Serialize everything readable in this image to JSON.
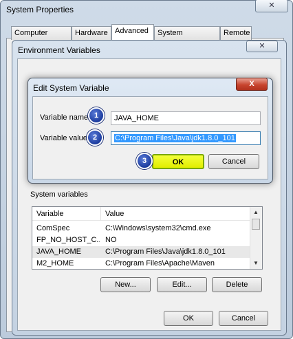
{
  "system_properties": {
    "title": "System Properties",
    "close_label": "✕",
    "tabs": [
      {
        "label": "Computer Name"
      },
      {
        "label": "Hardware"
      },
      {
        "label": "Advanced"
      },
      {
        "label": "System Protection"
      },
      {
        "label": "Remote"
      }
    ],
    "active_tab": "Advanced"
  },
  "environment_variables": {
    "title": "Environment Variables",
    "close_label": "✕",
    "system_variables": {
      "group_label": "System variables",
      "columns": [
        "Variable",
        "Value"
      ],
      "rows": [
        {
          "variable": "ComSpec",
          "value": "C:\\Windows\\system32\\cmd.exe"
        },
        {
          "variable": "FP_NO_HOST_C...",
          "value": "NO"
        },
        {
          "variable": "JAVA_HOME",
          "value": "C:\\Program Files\\Java\\jdk1.8.0_101"
        },
        {
          "variable": "M2_HOME",
          "value": "C:\\Program Files\\Apache\\Maven"
        }
      ],
      "selected_row": "JAVA_HOME",
      "buttons": {
        "new": "New...",
        "edit": "Edit...",
        "delete": "Delete"
      }
    },
    "ok_label": "OK",
    "cancel_label": "Cancel"
  },
  "edit_dialog": {
    "title": "Edit System Variable",
    "close_label": "X",
    "name_label": "Variable name:",
    "name_value": "JAVA_HOME",
    "value_label": "Variable value:",
    "value_value": "C:\\Program Files\\Java\\jdk1.8.0_101",
    "ok_label": "OK",
    "cancel_label": "Cancel"
  },
  "step_badges": [
    "1",
    "2",
    "3"
  ],
  "colors": {
    "highlight_ok": "#e8f000",
    "badge_blue": "#1c3c9e",
    "selection_blue": "#3399ff",
    "close_red": "#c8452f"
  }
}
